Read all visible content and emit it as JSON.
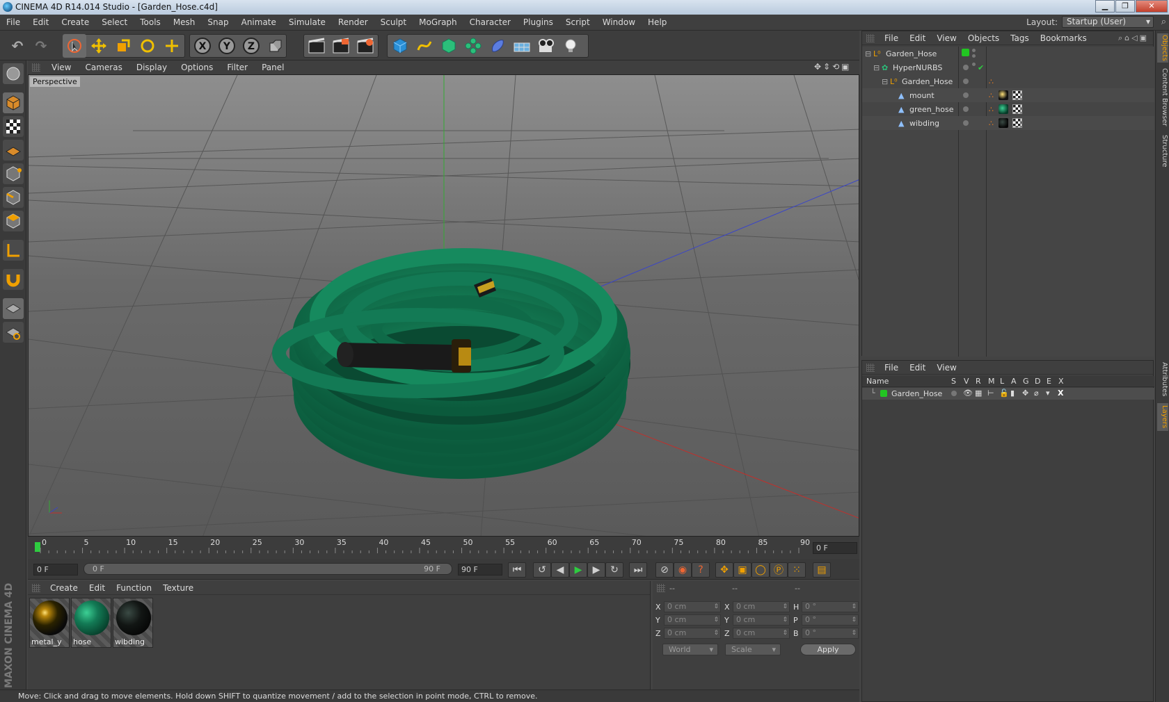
{
  "window": {
    "title": "CINEMA 4D R14.014 Studio - [Garden_Hose.c4d]"
  },
  "menu": [
    "File",
    "Edit",
    "Create",
    "Select",
    "Tools",
    "Mesh",
    "Snap",
    "Animate",
    "Simulate",
    "Render",
    "Sculpt",
    "MoGraph",
    "Character",
    "Plugins",
    "Script",
    "Window",
    "Help"
  ],
  "layout": {
    "label": "Layout:",
    "value": "Startup (User)"
  },
  "viewport": {
    "menu": [
      "View",
      "Cameras",
      "Display",
      "Options",
      "Filter",
      "Panel"
    ],
    "label": "Perspective"
  },
  "timeline": {
    "ticks": [
      "0",
      "5",
      "10",
      "15",
      "20",
      "25",
      "30",
      "35",
      "40",
      "45",
      "50",
      "55",
      "60",
      "65",
      "70",
      "75",
      "80",
      "85",
      "90"
    ],
    "current_frame": "0 F",
    "start_frame": "0 F",
    "range_start": "0 F",
    "range_end": "90 F",
    "end_frame": "90 F"
  },
  "materials": {
    "menu": [
      "Create",
      "Edit",
      "Function",
      "Texture"
    ],
    "items": [
      {
        "name": "metal_y"
      },
      {
        "name": "hose"
      },
      {
        "name": "wibding"
      }
    ]
  },
  "coords": {
    "header": [
      "--",
      "--",
      "--"
    ],
    "rows": [
      {
        "l1": "X",
        "v1": "0 cm",
        "l2": "X",
        "v2": "0 cm",
        "l3": "H",
        "v3": "0 °"
      },
      {
        "l1": "Y",
        "v1": "0 cm",
        "l2": "Y",
        "v2": "0 cm",
        "l3": "P",
        "v3": "0 °"
      },
      {
        "l1": "Z",
        "v1": "0 cm",
        "l2": "Z",
        "v2": "0 cm",
        "l3": "B",
        "v3": "0 °"
      }
    ],
    "space": "World",
    "mode": "Scale",
    "apply": "Apply"
  },
  "objects": {
    "menu": [
      "File",
      "Edit",
      "View",
      "Objects",
      "Tags",
      "Bookmarks"
    ],
    "tree": [
      {
        "name": "Garden_Hose"
      },
      {
        "name": "HyperNURBS"
      },
      {
        "name": "Garden_Hose"
      },
      {
        "name": "mount"
      },
      {
        "name": "green_hose"
      },
      {
        "name": "wibding"
      }
    ]
  },
  "layers": {
    "menu": [
      "File",
      "Edit",
      "View"
    ],
    "columns": [
      "Name",
      "S",
      "V",
      "R",
      "M",
      "L",
      "A",
      "G",
      "D",
      "E",
      "X"
    ],
    "rows": [
      {
        "name": "Garden_Hose"
      }
    ]
  },
  "side_tabs": [
    "Objects",
    "Content Browser",
    "Structure",
    "Attributes",
    "Layers"
  ],
  "status": "Move: Click and drag to move elements. Hold down SHIFT to quantize movement / add to the selection in point mode, CTRL to remove.",
  "brand": "MAXON CINEMA 4D",
  "colors": {
    "accent": "#f0a000",
    "hose": "#137a55",
    "axis_x": "#c0302c",
    "axis_y": "#33aa33",
    "axis_z": "#3a45c8",
    "layer_green": "#22c522"
  }
}
